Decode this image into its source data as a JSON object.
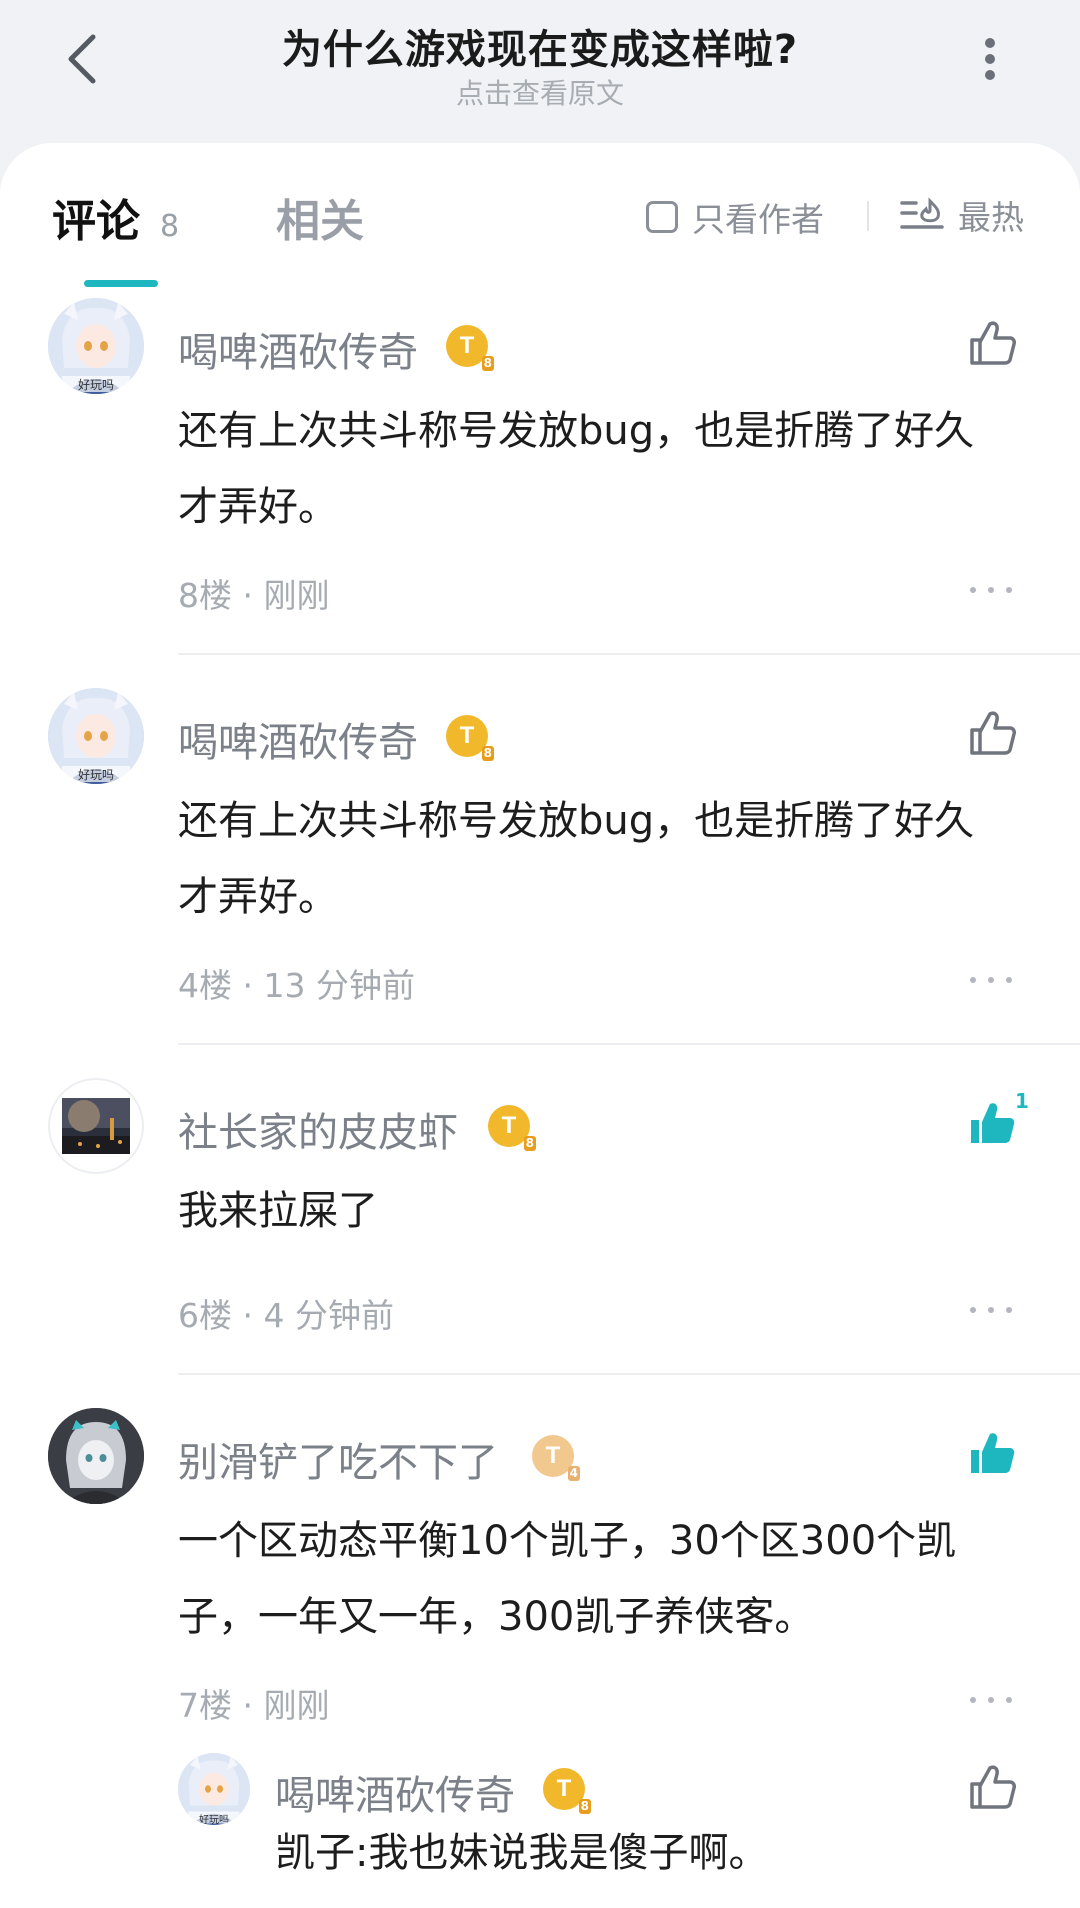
{
  "header": {
    "title": "为什么游戏现在变成这样啦?",
    "subtitle": "点击查看原文",
    "back_icon": "chevron-left-icon",
    "more_icon": "vertical-dots-icon"
  },
  "tabs": {
    "comments_label": "评论",
    "comments_count": "8",
    "related_label": "相关",
    "author_only_label": "只看作者",
    "sort_label": "最热",
    "accent_color": "#1fb7bf"
  },
  "comments": [
    {
      "username": "喝啤酒砍传奇",
      "badge": "T",
      "badge_level": "8",
      "text_line1": "还有上次共斗称号发放bug，也是折腾了好久",
      "text_line2": "才弄好。",
      "meta": "8楼 · 刚刚",
      "liked": false,
      "avatar_caption": "好玩吗"
    },
    {
      "username": "喝啤酒砍传奇",
      "badge": "T",
      "badge_level": "8",
      "text_line1": "还有上次共斗称号发放bug，也是折腾了好久",
      "text_line2": "才弄好。",
      "meta": "4楼 · 13 分钟前",
      "liked": false,
      "avatar_caption": "好玩吗"
    },
    {
      "username": "社长家的皮皮虾",
      "badge": "T",
      "badge_level": "8",
      "text_line1": "我来拉屎了",
      "meta": "6楼 · 4 分钟前",
      "liked": true,
      "like_count": "1"
    },
    {
      "username": "别滑铲了吃不下了",
      "badge": "T",
      "badge_level": "4",
      "text_line1": "一个区动态平衡10个凯子，30个区300个凯",
      "text_line2": "子，一年又一年，300凯子养侠客。",
      "meta": "7楼 · 刚刚",
      "liked": true
    }
  ],
  "reply": {
    "username": "喝啤酒砍传奇",
    "badge": "T",
    "badge_level": "8",
    "text": "凯子:我也妹说我是傻子啊。",
    "avatar_caption": "好玩吗",
    "liked": false
  }
}
